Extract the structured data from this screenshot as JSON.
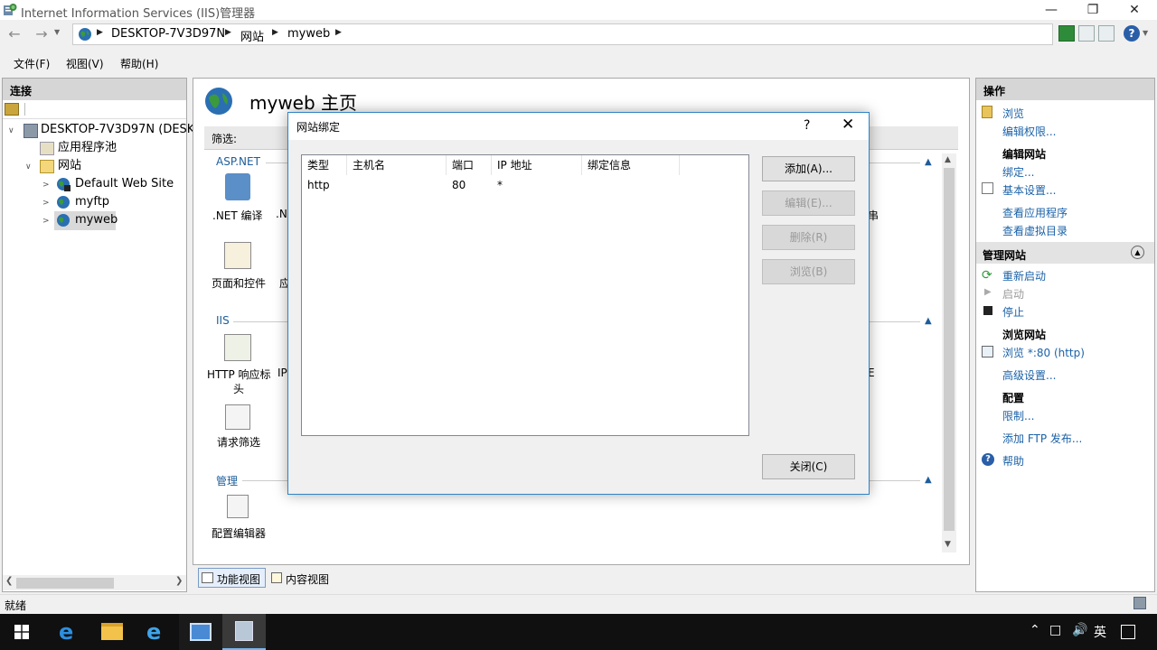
{
  "window": {
    "title": "Internet Information Services (IIS)管理器"
  },
  "address": {
    "crumbs": [
      "DESKTOP-7V3D97N",
      "网站",
      "myweb"
    ]
  },
  "menu": {
    "items": [
      "文件(F)",
      "视图(V)",
      "帮助(H)"
    ]
  },
  "connections": {
    "title": "连接",
    "server": "DESKTOP-7V3D97N (DESKT",
    "app_pools": "应用程序池",
    "sites_node": "网站",
    "sites": [
      "Default Web Site",
      "myftp",
      "myweb"
    ]
  },
  "center": {
    "title": "myweb 主页",
    "filter_label": "筛选:",
    "groups": {
      "aspnet": "ASP.NET",
      "iis": "IIS",
      "management": "管理"
    },
    "features": {
      "net_compile": ".NET 编译",
      "net_partial": ".N",
      "pages_controls": "页面和控件",
      "app_partial": "应",
      "http_headers_line1": "HTTP 响应标",
      "http_headers_line2": "头",
      "ip_partial": "IP",
      "request_filter": "请求筛选",
      "config_editor": "配置编辑器",
      "right_partial_1": "串",
      "right_partial_2": "E"
    },
    "views": {
      "feature": "功能视图",
      "content": "内容视图"
    }
  },
  "actions": {
    "title": "操作",
    "browse": "浏览",
    "edit_permissions": "编辑权限...",
    "edit_site_head": "编辑网站",
    "bindings": "绑定...",
    "basic_settings": "基本设置...",
    "view_apps": "查看应用程序",
    "view_vdirs": "查看虚拟目录",
    "manage_site_head": "管理网站",
    "restart": "重新启动",
    "start": "启动",
    "stop": "停止",
    "browse_site_head": "浏览网站",
    "browse_port": "浏览 *:80 (http)",
    "advanced_settings": "高级设置...",
    "config_head": "配置",
    "limits": "限制...",
    "add_ftp": "添加 FTP 发布...",
    "help": "帮助"
  },
  "dialog": {
    "title": "网站绑定",
    "help_mark": "?",
    "columns": [
      "类型",
      "主机名",
      "端口",
      "IP 地址",
      "绑定信息"
    ],
    "rows": [
      {
        "type": "http",
        "host": "",
        "port": "80",
        "ip": "*",
        "info": ""
      }
    ],
    "buttons": {
      "add": "添加(A)...",
      "edit": "编辑(E)...",
      "remove": "删除(R)",
      "browse": "浏览(B)",
      "close": "关闭(C)"
    }
  },
  "status": {
    "text": "就绪"
  },
  "tray": {
    "ime": "英"
  },
  "colors": {
    "accent": "#1b62a8",
    "dialog_border": "#2f84c7"
  }
}
